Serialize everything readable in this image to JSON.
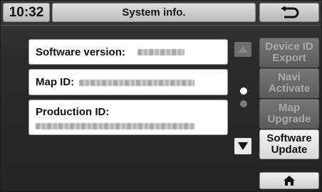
{
  "header": {
    "time": "10:32",
    "title": "System info.",
    "back_icon": "return-arrow-icon"
  },
  "info": {
    "software_version_label": "Software version:",
    "map_id_label": "Map ID:",
    "production_id_label": "Production ID:"
  },
  "scroll": {
    "up_icon": "triangle-up-icon",
    "down_icon": "triangle-down-icon",
    "page_count": 2,
    "current_page": 1
  },
  "side_buttons": [
    {
      "line1": "Device ID",
      "line2": "Export",
      "state": "disabled"
    },
    {
      "line1": "Navi",
      "line2": "Activate",
      "state": "disabled"
    },
    {
      "line1": "Map",
      "line2": "Upgrade",
      "state": "disabled"
    },
    {
      "line1": "Software",
      "line2": "Update",
      "state": "enabled"
    }
  ],
  "home": {
    "icon": "home-icon"
  },
  "colors": {
    "screen_bg": "#2b2b2b",
    "card_bg": "#ffffff",
    "button_disabled": "#6a6a6a",
    "button_active": "#e6e6e6"
  }
}
